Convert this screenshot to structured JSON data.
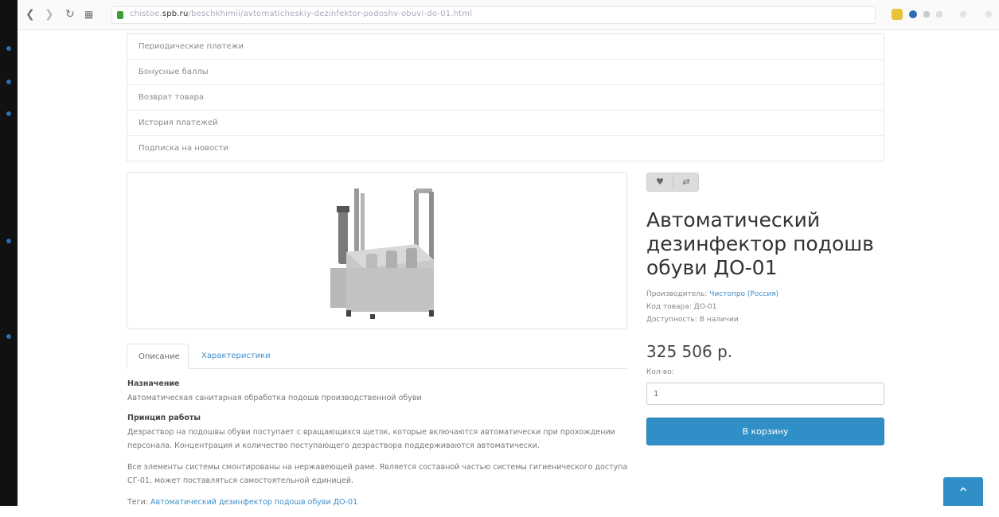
{
  "browser": {
    "url_prefix": "chistoe.",
    "url_domain": "spb.ru",
    "url_path": "/beschkhimii/avtomaticheskiy-dezinfektor-podoshv-obuvi-do-01.html"
  },
  "menu": {
    "items": [
      "Периодические платежи",
      "Бонусные баллы",
      "Возврат товара",
      "История платежей",
      "Подписка на новости"
    ]
  },
  "product": {
    "title": "Автоматический дезинфектор подошв обуви ДО-01",
    "manufacturer_label": "Производитель: ",
    "manufacturer_value": "Чистопро (Россия)",
    "code_label": "Код товара: ",
    "code_value": "ДО-01",
    "availability_label": "Доступность: ",
    "availability_value": "В наличии",
    "price": "325 506 р.",
    "qty_label": "Кол-во:",
    "qty_value": "1",
    "cart_label": "В корзину"
  },
  "tabs": {
    "description": "Описание",
    "specs": "Характеристики"
  },
  "description": {
    "purpose_heading": "Назначение",
    "purpose_text": "Автоматическая санитарная обработка подошв производственной обуви",
    "principle_heading": "Принцип работы",
    "principle_text": "Дезраствор на подошвы обуви поступает с вращающихся щеток, которые включаются автоматически при прохождении персонала. Концентрация и количество поступающего дезраствора поддерживаются автоматически.",
    "elements_text": "Все элементы системы смонтированы на нержавеющей раме. Является составной частью системы гигиенического доступа СГ-01, может поставляться самостоятельной единицей.",
    "tags_label": "Теги: ",
    "tags_value": "Автоматический дезинфектор подошв обуви ДО-01"
  },
  "buttons": {
    "wishlist_icon": "heart-icon",
    "compare_icon": "compare-icon",
    "scroll_top_icon": "chevron-up-icon"
  },
  "colors": {
    "accent": "#2f8fc6",
    "link": "#3b8fc9"
  }
}
